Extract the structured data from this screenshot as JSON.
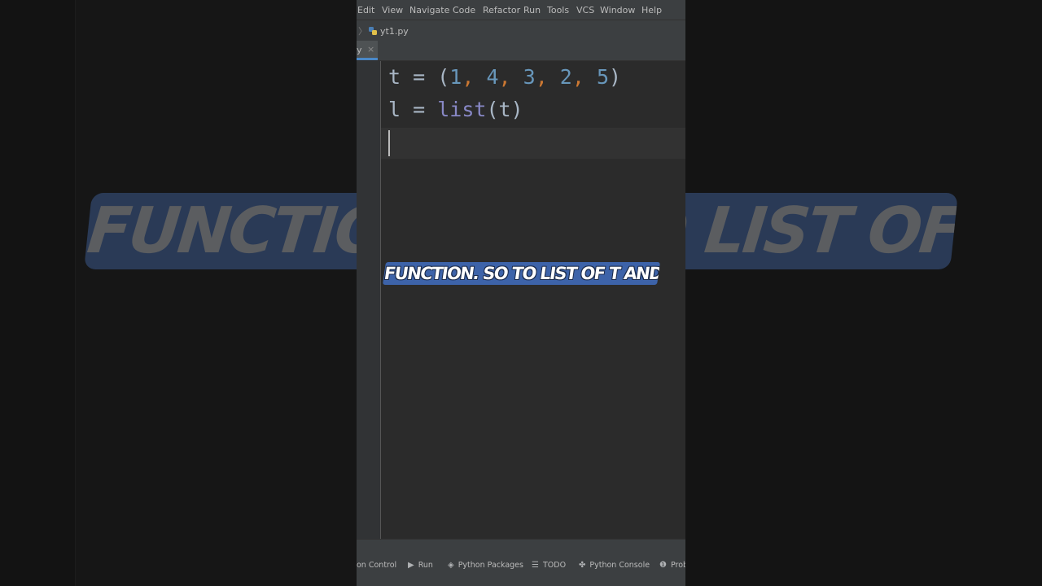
{
  "menu": [
    {
      "label": "Edit"
    },
    {
      "label": "View"
    },
    {
      "label": "Navigate"
    },
    {
      "label": "Code"
    },
    {
      "label": "Refactor"
    },
    {
      "label": "Run"
    },
    {
      "label": "Tools"
    },
    {
      "label": "VCS"
    },
    {
      "label": "Window"
    },
    {
      "label": "Help"
    }
  ],
  "breadcrumb": {
    "file": "yt1.py"
  },
  "tab": {
    "label": "y",
    "close": "×"
  },
  "code": {
    "line1": {
      "var": "t",
      "op": " = ",
      "open": "(",
      "n1": "1",
      "n2": "4",
      "n3": "3",
      "n4": "2",
      "n5": "5",
      "close": ")"
    },
    "line2": {
      "var": "l",
      "op": " = ",
      "fn": "list",
      "arg": "(t)"
    }
  },
  "caption": "FUNCTION. SO TO LIST OF T AND THEN",
  "background_caption": "FUNCTION. SO TO LIST OF T AND THEN",
  "toolwindows": [
    {
      "label": "on Control",
      "icon": "version-control-icon"
    },
    {
      "label": "Run",
      "icon": "run-icon"
    },
    {
      "label": "Python Packages",
      "icon": "packages-icon"
    },
    {
      "label": "TODO",
      "icon": "todo-icon"
    },
    {
      "label": "Python Console",
      "icon": "python-console-icon"
    },
    {
      "label": "Prob",
      "icon": "problems-icon"
    }
  ],
  "colors": {
    "accent": "#4a88c7",
    "caption_bg": "#3d63a9",
    "number": "#6897bb",
    "comma": "#cc7832",
    "builtin": "#8888c6"
  }
}
